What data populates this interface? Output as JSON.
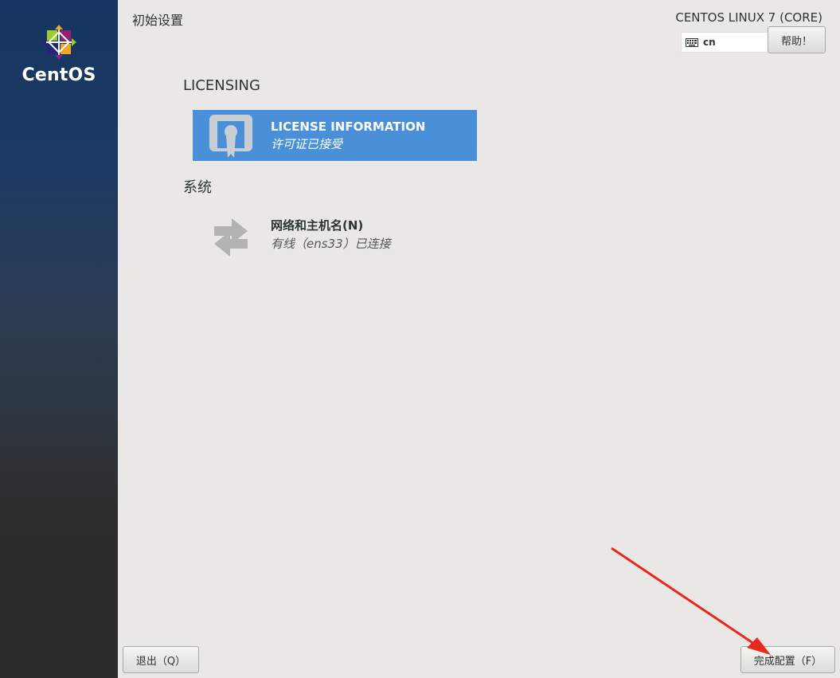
{
  "sidebar": {
    "brand": "CentOS"
  },
  "header": {
    "page_title": "初始设置",
    "product_title": "CENTOS LINUX 7 (CORE)",
    "keyboard_layout": "cn",
    "help_label": "帮助！"
  },
  "sections": {
    "licensing": {
      "heading": "LICENSING",
      "spoke": {
        "title": "LICENSE INFORMATION",
        "status": "许可证已接受",
        "icon": "license-icon"
      }
    },
    "system": {
      "heading": "系统",
      "spoke": {
        "title": "网络和主机名(N)",
        "status": "有线（ens33）已连接",
        "icon": "network-icon"
      }
    }
  },
  "footer": {
    "quit_label": "退出（Q）",
    "finish_label": "完成配置（F）"
  },
  "colors": {
    "accent": "#4a90d9",
    "annotation_arrow": "#e8281e"
  }
}
